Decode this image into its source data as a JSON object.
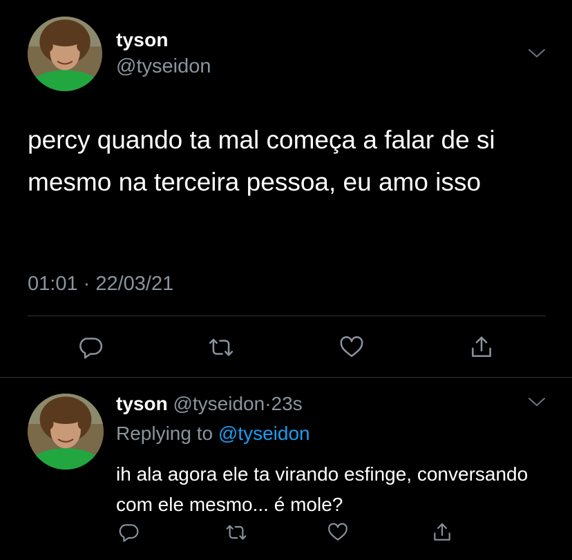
{
  "main_tweet": {
    "display_name": "tyson",
    "handle": "@tyseidon",
    "text": "percy quando ta mal começa a falar de si mesmo na terceira pessoa, eu amo isso",
    "timestamp": "01:01 · 22/03/21",
    "avatar_icon": "profile-photo",
    "menu_icon": "chevron-down-icon"
  },
  "reply_tweet": {
    "display_name": "tyson",
    "handle": "@tyseidon",
    "dot": "·",
    "time": "23s",
    "replying_prefix": "Replying to",
    "replying_mention": "@tyseidon",
    "text": "ih ala agora ele ta virando esfinge, conversando com ele mesmo... é mole?",
    "avatar_icon": "profile-photo",
    "menu_icon": "chevron-down-icon"
  },
  "actions": [
    "reply-icon",
    "retweet-icon",
    "like-icon",
    "share-icon"
  ],
  "colors": {
    "background": "#000000",
    "text": "#ffffff",
    "secondary": "#8a949e",
    "mention": "#1d9bf0",
    "divider": "#2f3336"
  }
}
